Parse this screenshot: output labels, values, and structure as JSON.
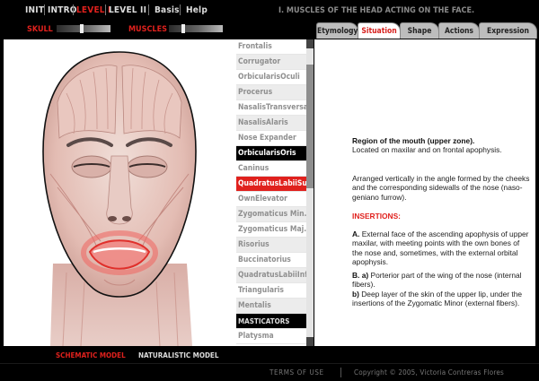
{
  "nav": {
    "items": [
      "INIT",
      "INTRO",
      "LEVEL I",
      "LEVEL II",
      "Basis",
      "Help"
    ],
    "active_index": 2,
    "title": "I. MUSCLES OF THE HEAD ACTING ON THE FACE."
  },
  "controls": {
    "skull_label": "SKULL",
    "muscles_label": "MUSCLES"
  },
  "tabs": {
    "items": [
      "Etymology",
      "Situation",
      "Shape",
      "Actions",
      "Expression"
    ],
    "active_index": 1
  },
  "muscles": {
    "items": [
      "Frontalis",
      "Corrugator",
      "OrbicularisOculi",
      "Procerus",
      "NasalisTransversa",
      "NasalisAlaris",
      "Nose Expander",
      "OrbicularisOris",
      "Caninus",
      "QuadratusLabiiSup.",
      "OwnElevator",
      "Zygomaticus Min.",
      "Zygomaticus Maj.",
      "Risorius",
      "Buccinatorius",
      "QuadratusLabiiInf.",
      "Triangularis",
      "Mentalis",
      "MASTICATORS",
      "Platysma"
    ],
    "selected_index": 7,
    "highlighted_index": 9,
    "header_index": 18
  },
  "info": {
    "region_title": "Region of the mouth (upper zone).",
    "region_text": "Located on maxilar and on frontal apophysis.",
    "arrangement": "Arranged vertically in the angle formed by the cheeks and the corresponding sidewalls of the nose (naso-geniano furrow).",
    "insertions_title": "INSERTIONS:",
    "a_label": "A.",
    "a_text": "External face of the ascending apophysis of upper maxilar, with meeting points with the own bones of the nose and, sometimes, with the external orbital apophysis.",
    "b_label": "B. a)",
    "b_text": "Porterior part of the wing of the nose (internal fibers).",
    "b2_label": "b)",
    "b2_text": "Deep layer of the skin of the upper lip, under the insertions of the Zygomatic Minor (external fibers)."
  },
  "models": {
    "schematic": "SCHEMATIC MODEL",
    "naturalistic": "NATURALISTIC MODEL",
    "active": "schematic"
  },
  "footer": {
    "terms": "TERMS OF USE",
    "copyright": "Copyright © 2005, Victoria Contreras Flores"
  },
  "colors": {
    "accent": "#e0211d",
    "background": "#000000",
    "panel": "#ffffff"
  }
}
